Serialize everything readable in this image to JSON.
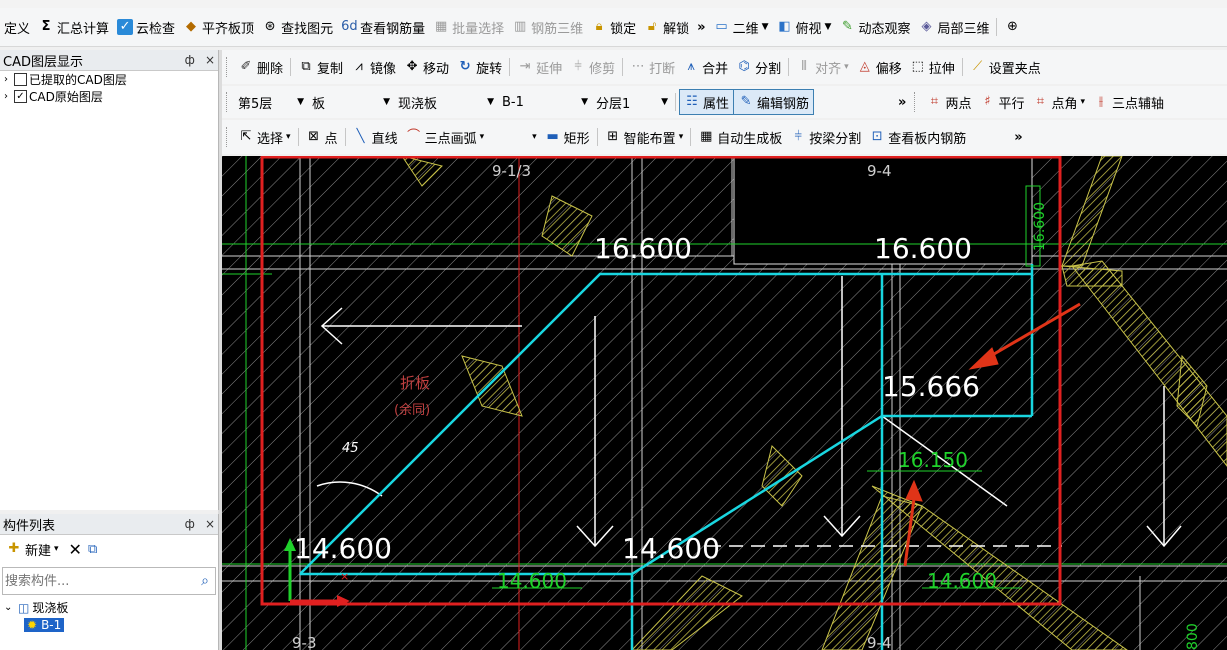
{
  "toolbar_main": {
    "items": [
      "定义",
      "汇总计算",
      "云检查",
      "平齐板顶",
      "查找图元",
      "查看钢筋量",
      "批量选择",
      "钢筋三维",
      "锁定",
      "解锁",
      "二维",
      "俯视",
      "动态观察",
      "局部三维"
    ],
    "overflow": "»"
  },
  "toolbar_edit": {
    "items": [
      "删除",
      "复制",
      "镜像",
      "移动",
      "旋转",
      "延伸",
      "修剪",
      "打断",
      "合并",
      "分割",
      "对齐",
      "偏移",
      "拉伸",
      "设置夹点"
    ]
  },
  "toolbar_props": {
    "floor": "第5层",
    "type": "板",
    "subtype": "现浇板",
    "component": "B-1",
    "layer": "分层1",
    "attr_label": "属性",
    "edit_rebar": "编辑钢筋",
    "overflow": "»",
    "snap_items": [
      "两点",
      "平行",
      "点角",
      "三点辅轴"
    ]
  },
  "toolbar_draw": {
    "items": [
      "选择",
      "点",
      "直线",
      "三点画弧",
      "矩形",
      "智能布置",
      "自动生成板",
      "按梁分割",
      "查看板内钢筋"
    ],
    "overflow": "»"
  },
  "layer_panel": {
    "title": "CAD图层显示",
    "pin": "ф",
    "close": "×",
    "items": [
      {
        "label": "已提取的CAD图层",
        "checked": false
      },
      {
        "label": "CAD原始图层",
        "checked": true
      }
    ]
  },
  "component_panel": {
    "title": "构件列表",
    "pin": "ф",
    "close": "×",
    "new_label": "新建",
    "search_placeholder": "搜索构件...",
    "tree": [
      {
        "label": "现浇板",
        "children": [
          "B-1"
        ]
      }
    ]
  },
  "canvas": {
    "labels": {
      "axis_top_left": "9-1/3",
      "axis_top_right": "9-4",
      "axis_bottom_left": "9-3",
      "axis_bottom_right": "9-4",
      "elev_top_left": "16.600",
      "elev_top_right": "16.600",
      "elev_mid": "15.666",
      "elev_green_mid": "16.150",
      "elev_bot_left": "14.600",
      "elev_bot_mid": "14.600",
      "elev_green_bot_left": "14.600",
      "elev_green_bot_right": "14.600",
      "elev_vertical_right": "16.600",
      "angle": "45",
      "note_line1": "折板",
      "note_line2": "(余同)",
      "elev_vertical_br": "800"
    },
    "colors": {
      "background": "#000000",
      "cyan": "#19d6e0",
      "white": "#ffffff",
      "yellow": "#c9c34a",
      "green": "#1fd22b",
      "red_box": "#e02020",
      "red_arrow": "#e03418",
      "hatch": "#8a8a8a"
    }
  }
}
